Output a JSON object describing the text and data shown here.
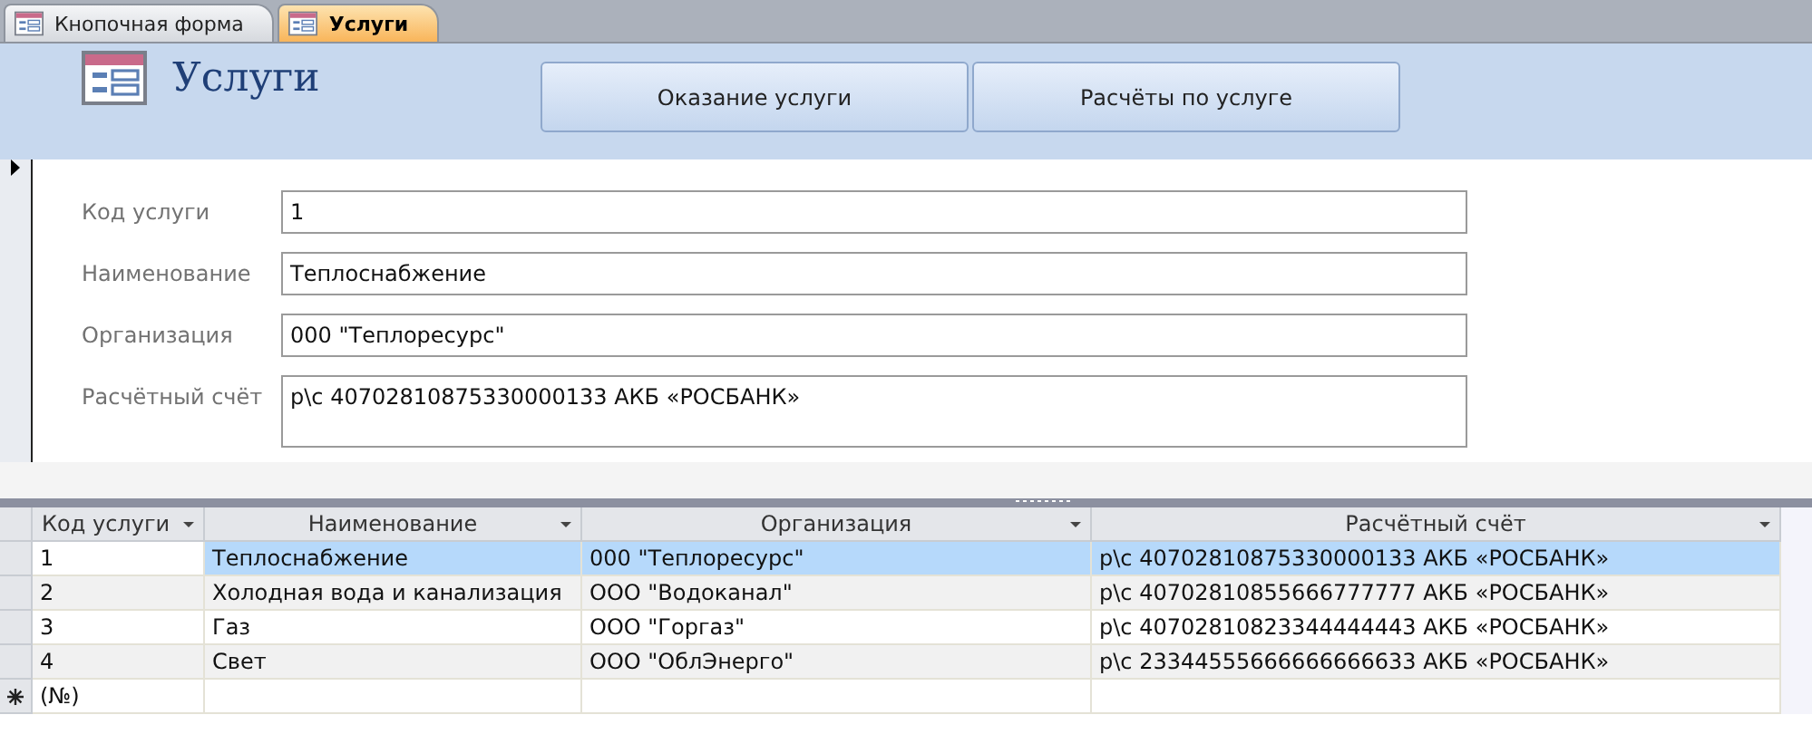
{
  "tabs": [
    {
      "label": "Кнопочная форма",
      "selected": false
    },
    {
      "label": "Услуги",
      "selected": true
    }
  ],
  "form": {
    "title": "Услуги",
    "buttons": [
      "Оказание услуги",
      "Расчёты по услуге"
    ],
    "fields": [
      {
        "label": "Код услуги",
        "value": "1",
        "kind": "short"
      },
      {
        "label": "Наименование",
        "value": "Теплоснабжение",
        "kind": "short"
      },
      {
        "label": "Организация",
        "value": "000 \"Теплоресурс\"",
        "kind": "short"
      },
      {
        "label": "Расчётный счёт",
        "value": "р\\с 40702810875330000133 АКБ «РОСБАНК»",
        "kind": "memo"
      }
    ]
  },
  "datasheet": {
    "columns": [
      "Код услуги",
      "Наименование",
      "Организация",
      "Расчётный счёт"
    ],
    "rows": [
      {
        "cells": [
          "1",
          "Теплоснабжение",
          "000 \"Теплоресурс\"",
          "р\\с 40702810875330000133 АКБ «РОСБАНК»"
        ],
        "selected": true
      },
      {
        "cells": [
          "2",
          "Холодная вода и канализация",
          "ООО \"Водоканал\"",
          "р\\с 40702810855666777777 АКБ «РОСБАНК»"
        ],
        "selected": false
      },
      {
        "cells": [
          "3",
          "Газ",
          "ООО \"Горгаз\"",
          "р\\с 40702810823344444443 АКБ «РОСБАНК»"
        ],
        "selected": false
      },
      {
        "cells": [
          "4",
          "Свет",
          "ООО \"ОблЭнерго\"",
          "р\\с 23344555666666666633 АКБ «РОСБАНК»"
        ],
        "selected": false
      }
    ],
    "new_row": "(№)"
  }
}
